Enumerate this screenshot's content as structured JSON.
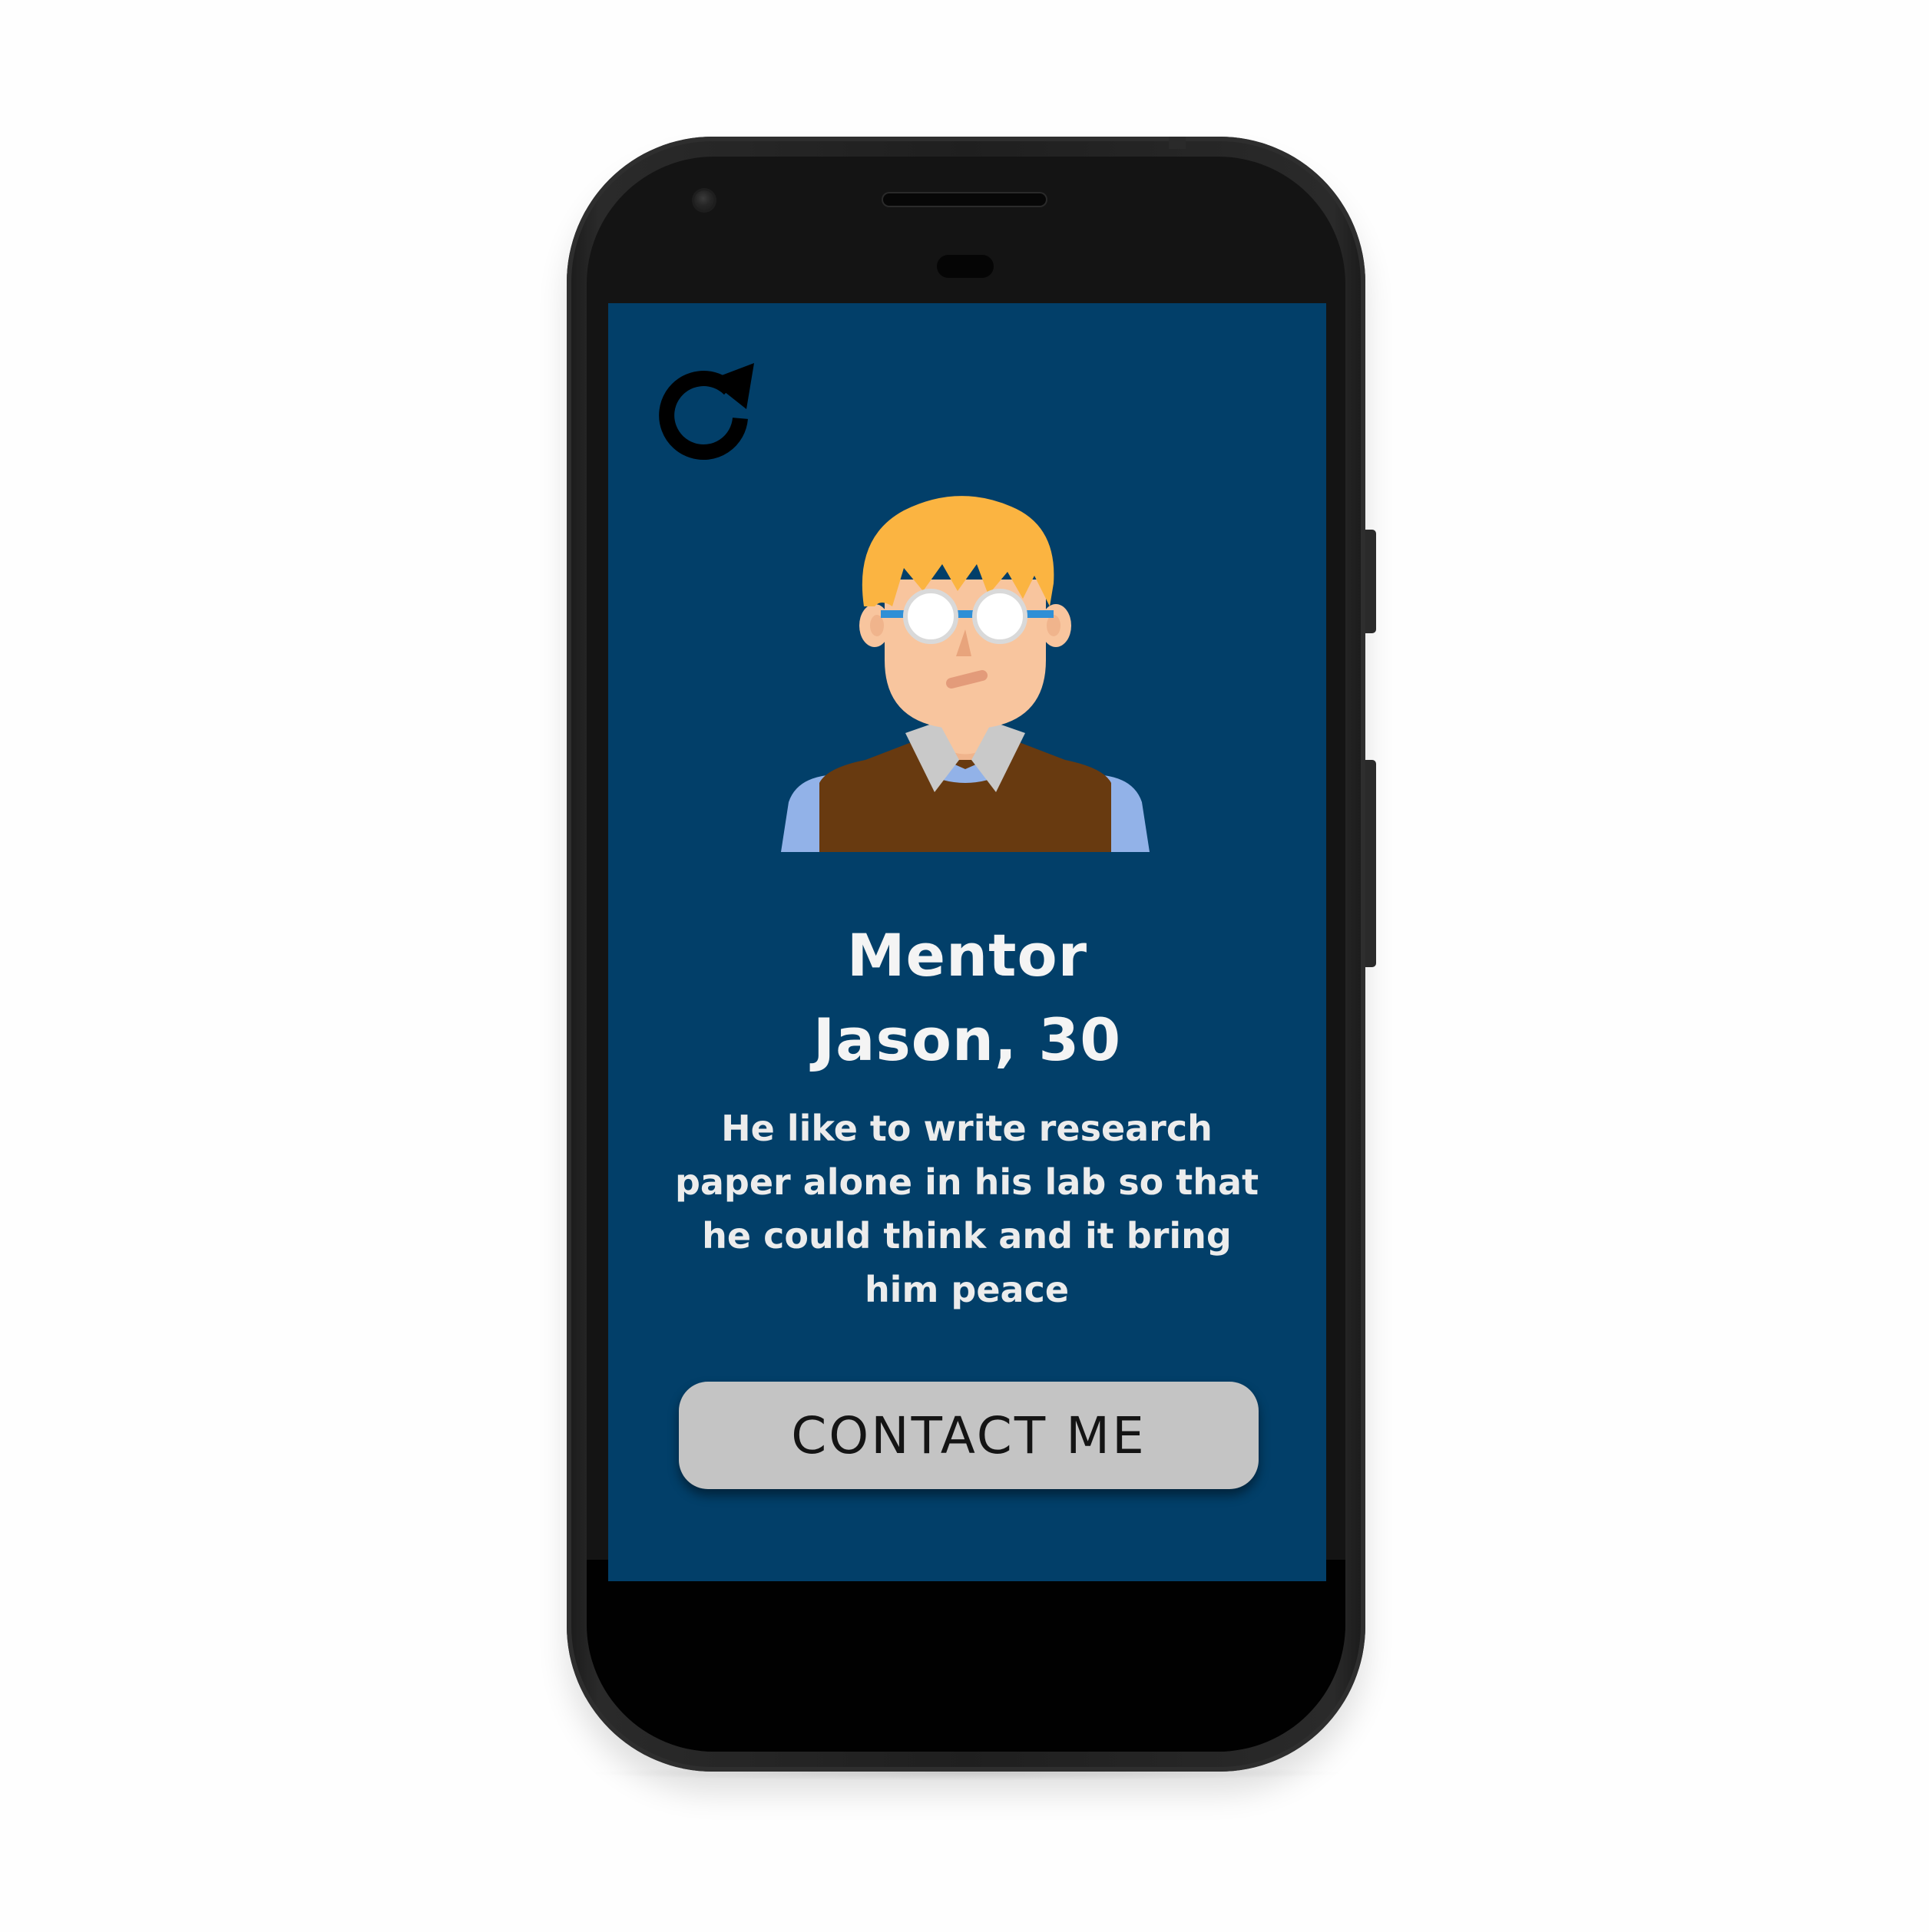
{
  "screen": {
    "background_color": "#023f69",
    "refresh_icon": "refresh-icon",
    "avatar_icon": "mentor-avatar-icon",
    "title_line1": "Mentor",
    "title_line2": "Jason, 30",
    "description": "He like to write research paper alone in his lab so that he could think and it bring him peace",
    "contact_button_label": "CONTACT ME",
    "contact_button_color": "#c4c4c4"
  }
}
